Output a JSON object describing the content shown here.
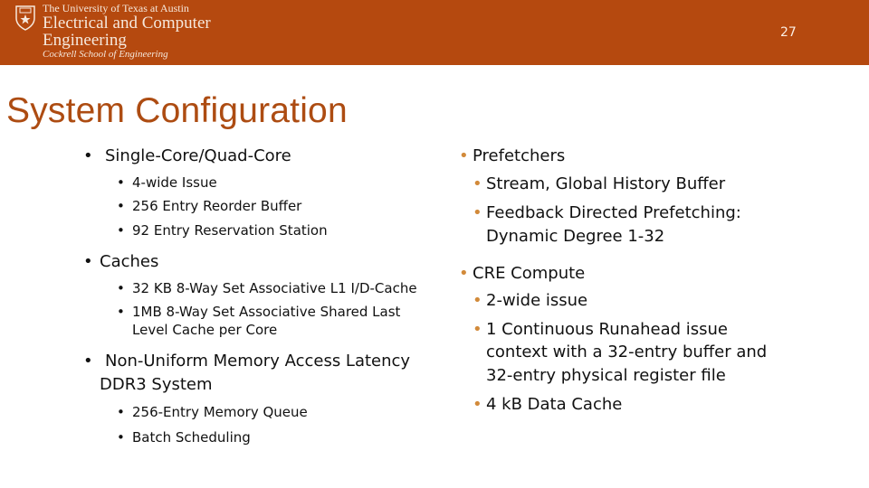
{
  "header": {
    "logo": {
      "icon": "ut-shield-icon",
      "line1": "The University of Texas at Austin",
      "line2": "Electrical and Computer",
      "line3": "Engineering",
      "line4": "Cockrell School of Engineering"
    },
    "page_number": "27",
    "bar_color": "#b5490f"
  },
  "title": "System Configuration",
  "left_column": [
    {
      "label": "Single-Core/Quad-Core",
      "sub": [
        "4-wide Issue",
        "256 Entry Reorder Buffer",
        "92 Entry Reservation Station"
      ]
    },
    {
      "label": "Caches",
      "sub": [
        "32 KB 8-Way Set Associative L1 I/D-Cache",
        "1MB 8-Way Set Associative Shared Last",
        "Level Cache per Core"
      ]
    },
    {
      "label": "Non-Uniform Memory Access Latency",
      "label_cont": "DDR3 System",
      "sub": [
        "256-Entry Memory Queue",
        "Batch Scheduling"
      ]
    }
  ],
  "right_column": [
    {
      "label": "Prefetchers",
      "sub": [
        "Stream, Global History Buffer",
        "Feedback Directed Prefetching:",
        "Dynamic Degree 1-32"
      ]
    },
    {
      "label": "CRE Compute",
      "sub": [
        "2-wide issue",
        "1 Continuous Runahead issue",
        "context with a 32-entry buffer and",
        "32-entry physical register file",
        "4 kB Data Cache"
      ]
    }
  ],
  "bullet_glyph": "•",
  "colors": {
    "title": "#ad4c12",
    "right_bullet": "#d28a3a"
  }
}
